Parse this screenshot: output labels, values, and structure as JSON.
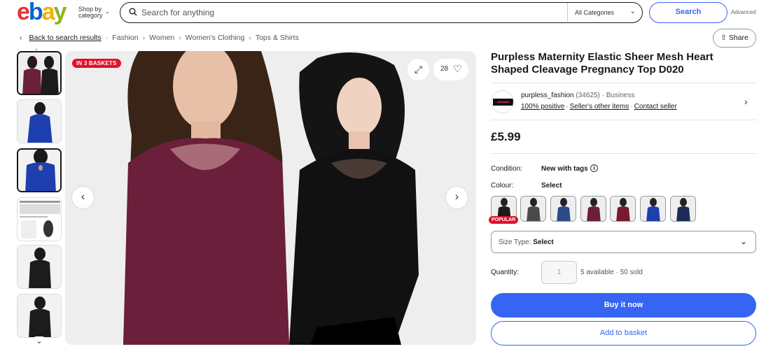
{
  "header": {
    "logo": [
      "e",
      "b",
      "a",
      "y"
    ],
    "shop_by": "Shop by",
    "category": "category",
    "search_placeholder": "Search for anything",
    "category_select": "All Categories",
    "search_button": "Search",
    "advanced": "Advanced",
    "brand_colors": [
      "#e53238",
      "#0064d2",
      "#f5af02",
      "#86b817"
    ]
  },
  "breadcrumb": {
    "back": "Back to search results",
    "items": [
      "Fashion",
      "Women",
      "Women's Clothing",
      "Tops & Shirts"
    ]
  },
  "share": "Share",
  "gallery": {
    "badge": "IN 3 BASKETS",
    "watch_count": "28"
  },
  "product": {
    "title": "Purpless Maternity Elastic Sheer Mesh Heart Shaped Cleavage Pregnancy Top D020",
    "seller": {
      "name": "purpless_fashion",
      "feedback_count": "(34625)",
      "type": "· Business",
      "positive": "100% positive",
      "other_items": "Seller's other items",
      "contact": "Contact seller"
    },
    "price": "£5.99",
    "condition_label": "Condition:",
    "condition_value": "New with tags",
    "colour_label": "Colour:",
    "colour_value": "Select",
    "popular_badge": "POPULAR",
    "size_type_label": "Size Type:",
    "size_type_value": "Select",
    "quantity_label": "Quantity:",
    "quantity_value": "1",
    "availability": "5 available · 50 sold",
    "buy_now": "Buy it now",
    "add_to_basket": "Add to basket"
  },
  "colors": {
    "accent": "#3665f3",
    "badge_red": "#e0102b",
    "swatches": [
      "#1c1c1c",
      "#4a4a4a",
      "#2c4a8a",
      "#6b1f3a",
      "#7a1a2e",
      "#1e3fb0",
      "#1c2a55"
    ]
  }
}
